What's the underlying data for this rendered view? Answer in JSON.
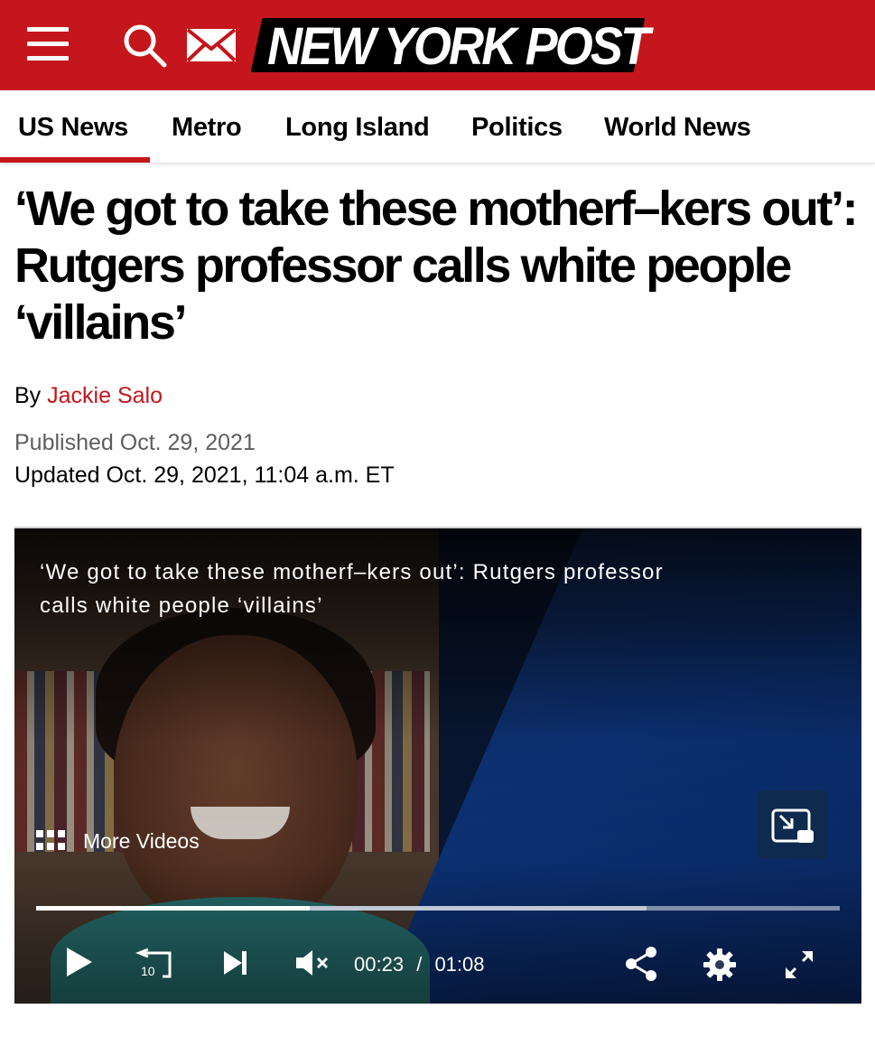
{
  "header": {
    "logo_text": "NEW YORK POST",
    "brand_color": "#c4161c",
    "icons": [
      "menu-icon",
      "search-icon",
      "mail-icon"
    ]
  },
  "nav": {
    "tabs": [
      {
        "label": "US News",
        "active": true
      },
      {
        "label": "Metro",
        "active": false
      },
      {
        "label": "Long Island",
        "active": false
      },
      {
        "label": "Politics",
        "active": false
      },
      {
        "label": "World News",
        "active": false
      }
    ]
  },
  "article": {
    "headline": "‘We got to take these motherf–kers out’: Rutgers professor calls white people ‘villains’",
    "byline_prefix": "By",
    "author": "Jackie Salo",
    "published": "Published Oct. 29, 2021",
    "updated": "Updated Oct. 29, 2021, 11:04 a.m. ET"
  },
  "video": {
    "title": "‘We got to take these motherf–kers out’: Rutgers professor calls white people ‘villains’",
    "more_videos_label": "More Videos",
    "current_time": "00:23",
    "separator": "/",
    "duration": "01:08",
    "played_fraction": 0.34,
    "buffered_fraction": 0.76,
    "skip_back_seconds": "10",
    "controls": [
      "play-icon",
      "replay-10-icon",
      "skip-next-icon",
      "volume-muted-icon",
      "share-icon",
      "settings-gear-icon",
      "fullscreen-icon",
      "picture-in-picture-icon",
      "more-videos-grid-icon"
    ]
  }
}
